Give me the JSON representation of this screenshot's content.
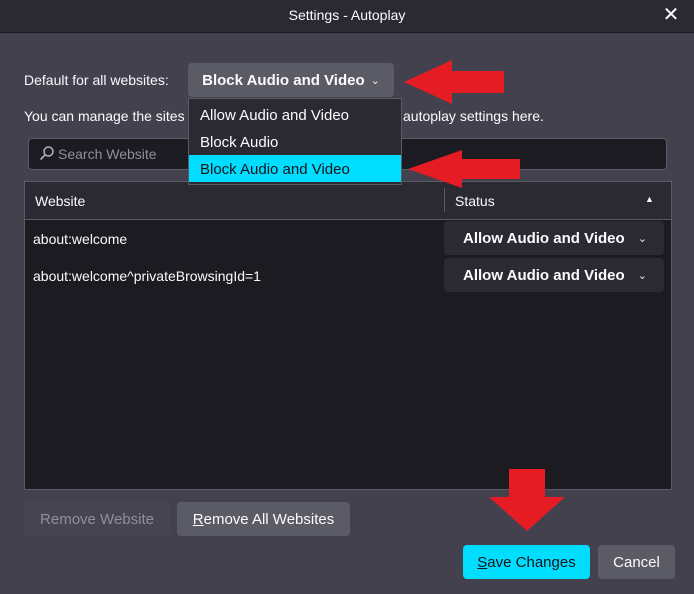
{
  "window": {
    "title": "Settings - Autoplay"
  },
  "default": {
    "label": "Default for all websites:",
    "selected": "Block Audio and Video",
    "options": [
      "Allow Audio and Video",
      "Block Audio",
      "Block Audio and Video"
    ]
  },
  "description": {
    "left": "You can manage the sites",
    "right": "autoplay settings here."
  },
  "search": {
    "placeholder": "Search Website"
  },
  "table": {
    "headers": {
      "website": "Website",
      "status": "Status"
    },
    "rows": [
      {
        "website": "about:welcome",
        "status": "Allow Audio and Video"
      },
      {
        "website": "about:welcome^privateBrowsingId=1",
        "status": "Allow Audio and Video"
      }
    ]
  },
  "buttons": {
    "remove_website": "Remove Website",
    "remove_all": "Remove All Websites",
    "save": "Save Changes",
    "cancel": "Cancel"
  },
  "colors": {
    "accent": "#00ddff",
    "annotation": "#e51c23"
  }
}
